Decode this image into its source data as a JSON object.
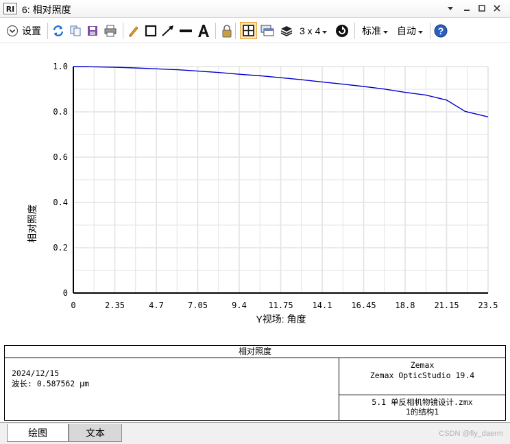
{
  "window": {
    "title": "6: 相对照度",
    "app_icon_text": "RI"
  },
  "toolbar": {
    "settings_label": "设置",
    "layout_label": "3 x 4",
    "standard_label": "标准",
    "auto_label": "自动"
  },
  "chart_data": {
    "type": "line",
    "title": "",
    "xlabel": "Y视场: 角度",
    "ylabel": "相对照度",
    "xlim": [
      0,
      23.5
    ],
    "ylim": [
      0,
      1.0
    ],
    "x_ticks": [
      "0",
      "2.35",
      "4.7",
      "7.05",
      "9.4",
      "11.75",
      "14.1",
      "16.45",
      "18.8",
      "21.15",
      "23.5"
    ],
    "y_ticks": [
      "0",
      "0.2",
      "0.4",
      "0.6",
      "0.8",
      "1.0"
    ],
    "grid": true,
    "series": [
      {
        "color": "#0000cc",
        "x": [
          0,
          1.0,
          2.35,
          3.5,
          4.7,
          5.9,
          7.05,
          8.2,
          9.4,
          10.6,
          11.75,
          12.9,
          14.1,
          15.3,
          16.45,
          17.6,
          18.8,
          19.98,
          21.15,
          22.2,
          23.5
        ],
        "y": [
          1.0,
          0.999,
          0.997,
          0.994,
          0.99,
          0.986,
          0.98,
          0.974,
          0.966,
          0.959,
          0.951,
          0.942,
          0.932,
          0.922,
          0.912,
          0.901,
          0.886,
          0.874,
          0.852,
          0.802,
          0.778
        ]
      }
    ]
  },
  "info": {
    "header": "相对照度",
    "date": "2024/12/15",
    "wavelength": "波长: 0.587562 µm",
    "company": "Zemax",
    "product": "Zemax OpticStudio 19.4",
    "file": "5.1 单反相机物镜设计.zmx",
    "config": "1的结构1"
  },
  "tabs": {
    "graph": "绘图",
    "text": "文本"
  },
  "watermark": "CSDN @fly_daerm"
}
